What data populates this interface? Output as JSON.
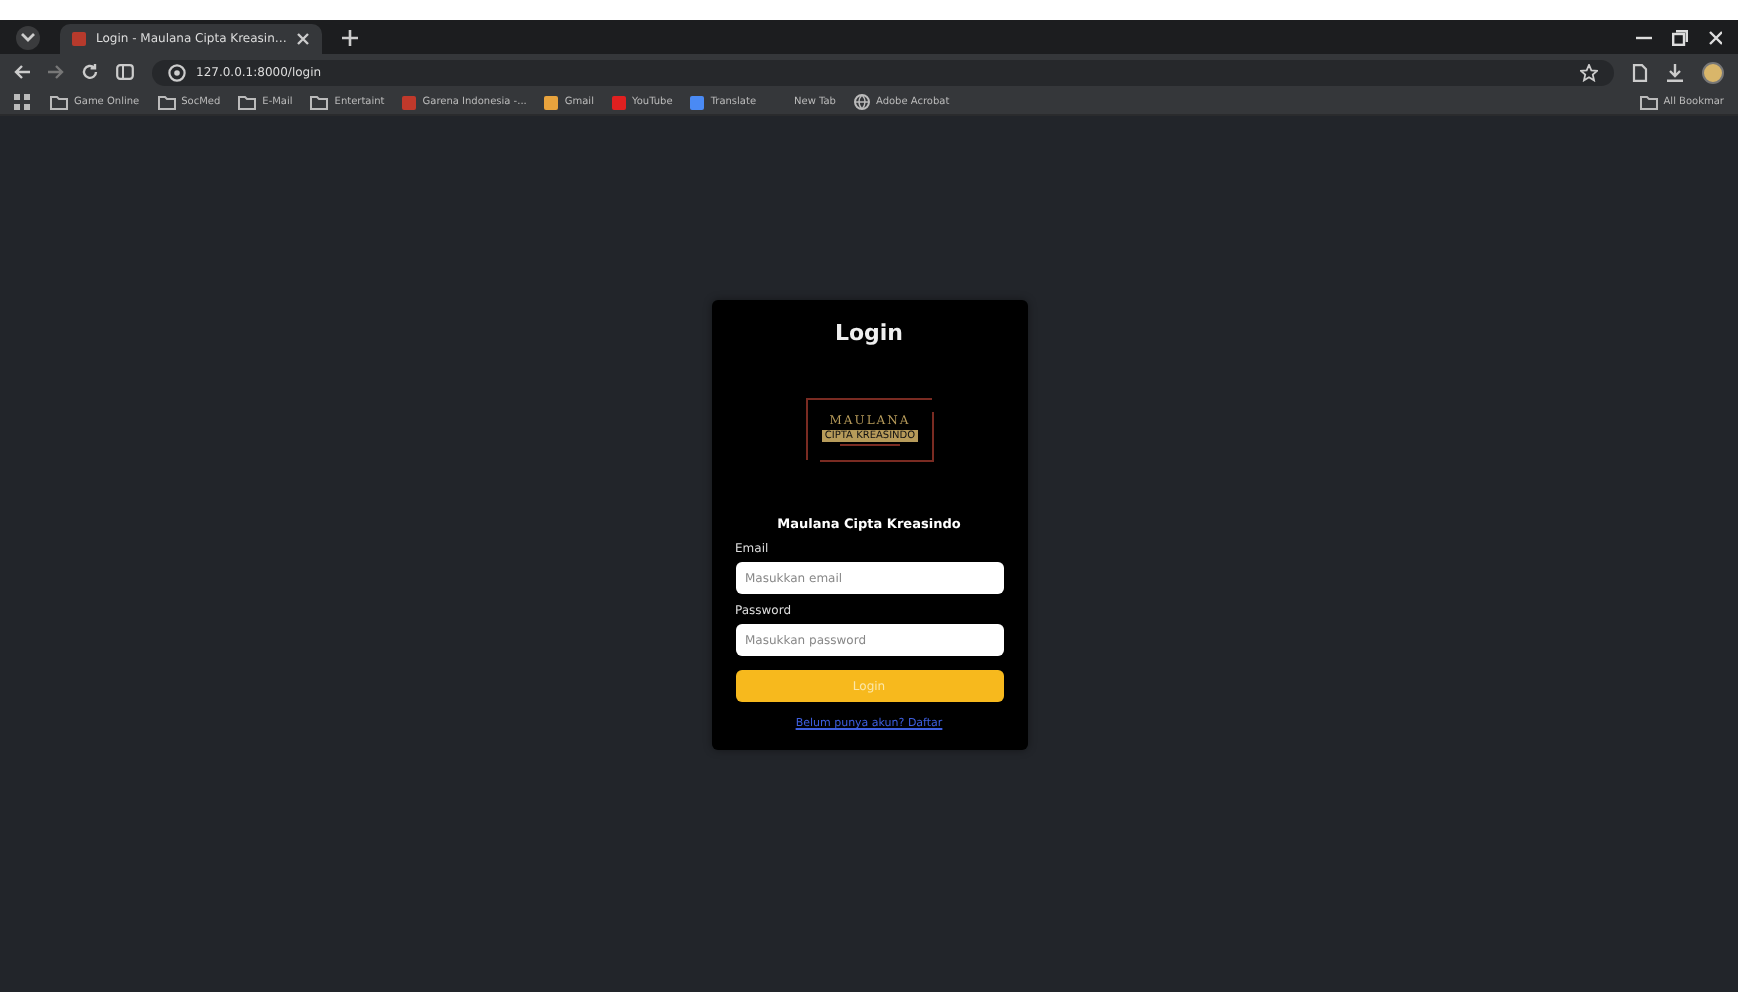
{
  "browser": {
    "tab": {
      "title": "Login - Maulana Cipta Kreasin…",
      "selected": true
    },
    "url": "127.0.0.1:8000/login",
    "bookmarks": [
      {
        "kind": "folder",
        "label": "Game Online"
      },
      {
        "kind": "folder",
        "label": "SocMed"
      },
      {
        "kind": "folder",
        "label": "E-Mail"
      },
      {
        "kind": "folder",
        "label": "Entertaint"
      },
      {
        "kind": "site",
        "label": "Garena Indonesia -...",
        "color": "#c0392b"
      },
      {
        "kind": "site",
        "label": "Gmail",
        "color": "#e8a33d"
      },
      {
        "kind": "site",
        "label": "YouTube",
        "color": "#e02020"
      },
      {
        "kind": "site",
        "label": "Translate",
        "color": "#4a8af4"
      },
      {
        "kind": "text",
        "label": "New Tab"
      },
      {
        "kind": "globe",
        "label": "Adobe Acrobat"
      }
    ],
    "all_bookmarks": "All Bookmar"
  },
  "login": {
    "title": "Login",
    "logo": {
      "name": "MAULANA",
      "tagline": "CIPTA KREASINDO"
    },
    "company": "Maulana Cipta Kreasindo",
    "fields": [
      {
        "label": "Email",
        "placeholder": "Masukkan email"
      },
      {
        "label": "Password",
        "placeholder": "Masukkan password"
      }
    ],
    "button": "Login",
    "link": "Belum punya akun? Daftar"
  }
}
